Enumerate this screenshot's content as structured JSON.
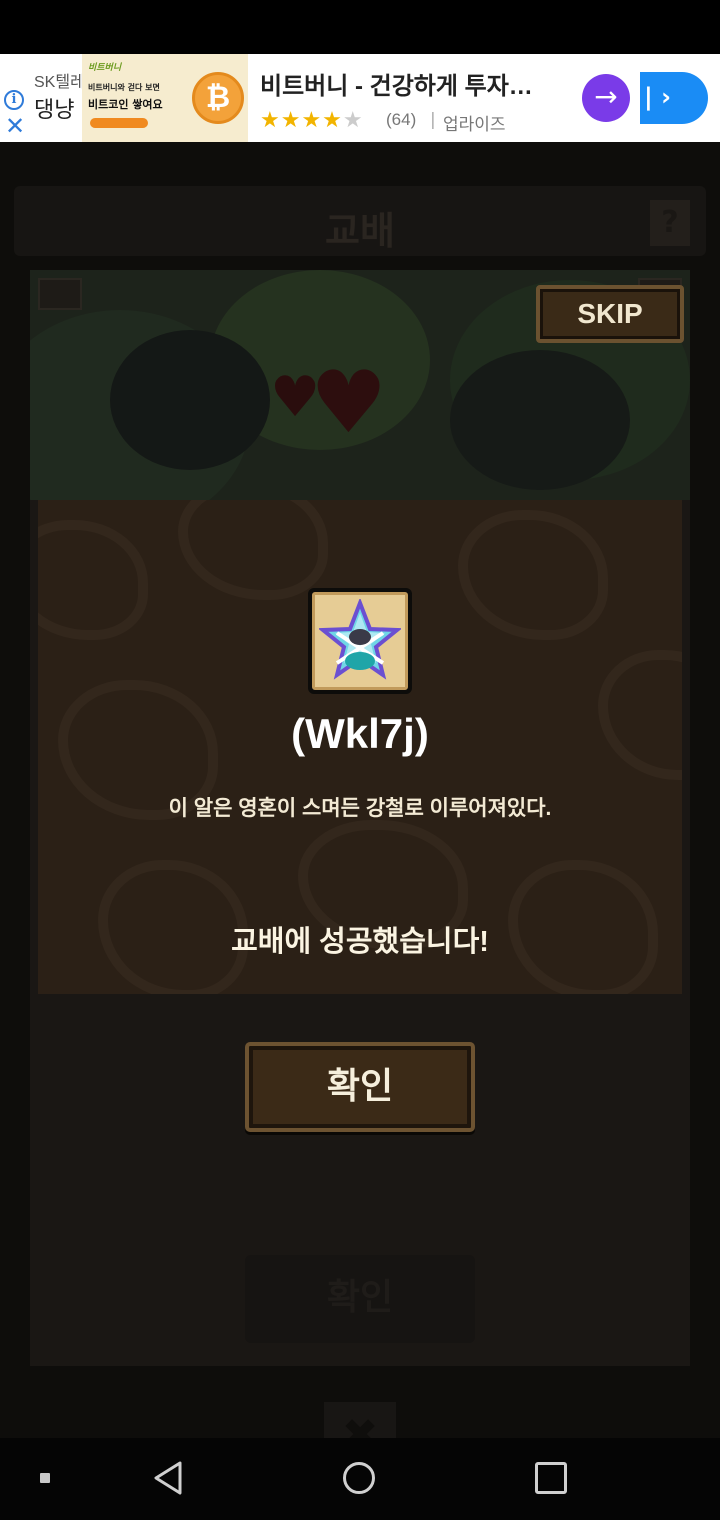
{
  "ad": {
    "advertiser": "SK텔레",
    "headline_cut": "댕냥",
    "image_logo": "비트버니",
    "image_line1": "비트버니와 걷다 보면",
    "image_line2": "비트코인 쌓여요",
    "coin_symbol": "₿",
    "title": "비트버니 - 건강하게 투자…",
    "rating_stars": "★★★★",
    "rating_empty": "★",
    "rating_count": "(64)",
    "separator": "|",
    "publisher": "업라이즈",
    "arrow_symbol": "→",
    "cta_symbol": "| ›",
    "info_symbol": "i",
    "close_symbol": "✕",
    "colors": {
      "cta": "#1a8cf5",
      "arrow": "#7a3be8",
      "star": "#f2b400"
    }
  },
  "game": {
    "window_title": "교배",
    "help_symbol": "?",
    "skip_label": "SKIP",
    "dialog": {
      "item_icon": "steel-star-egg-icon",
      "item_name": "(Wkl7j)",
      "item_description": "이 알은 영혼이 스며든 강철로 이루어져있다.",
      "success_message": "교배에 성공했습니다!"
    },
    "confirm_label": "확인",
    "lower_confirm_label": "확인",
    "close_symbol": "✖"
  },
  "nav": {
    "icons": [
      "menu-icon",
      "back-icon",
      "home-icon",
      "recent-apps-icon"
    ]
  }
}
